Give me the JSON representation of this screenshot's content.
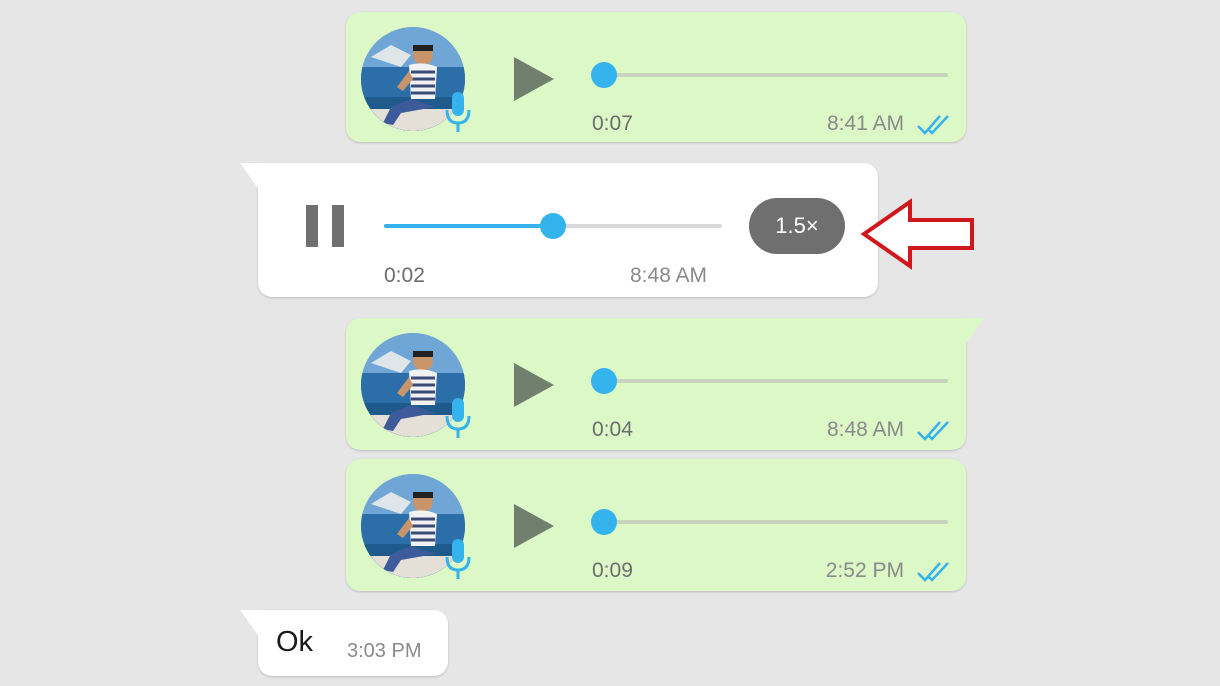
{
  "colors": {
    "background": "#e6e6e6",
    "outgoing_bubble": "#dcf8c6",
    "incoming_bubble": "#ffffff",
    "accent_blue": "#34b3ed",
    "annotation_red": "#d0171b"
  },
  "messages": [
    {
      "type": "voice",
      "direction": "outgoing",
      "duration": "0:07",
      "time": "8:41 AM",
      "status_icon": "double-check-read-icon"
    },
    {
      "type": "voice",
      "direction": "incoming",
      "state": "playing",
      "position": "0:02",
      "time": "8:48 AM",
      "progress_fraction": 0.5,
      "playback_speed": "1.5×",
      "icon": "pause-icon"
    },
    {
      "type": "voice",
      "direction": "outgoing",
      "duration": "0:04",
      "time": "8:48 AM",
      "status_icon": "double-check-read-icon"
    },
    {
      "type": "voice",
      "direction": "outgoing",
      "duration": "0:09",
      "time": "2:52 PM",
      "status_icon": "double-check-read-icon"
    },
    {
      "type": "text",
      "direction": "incoming",
      "text": "Ok",
      "time": "3:03 PM"
    }
  ],
  "annotation": {
    "icon": "red-arrow-left-icon"
  }
}
